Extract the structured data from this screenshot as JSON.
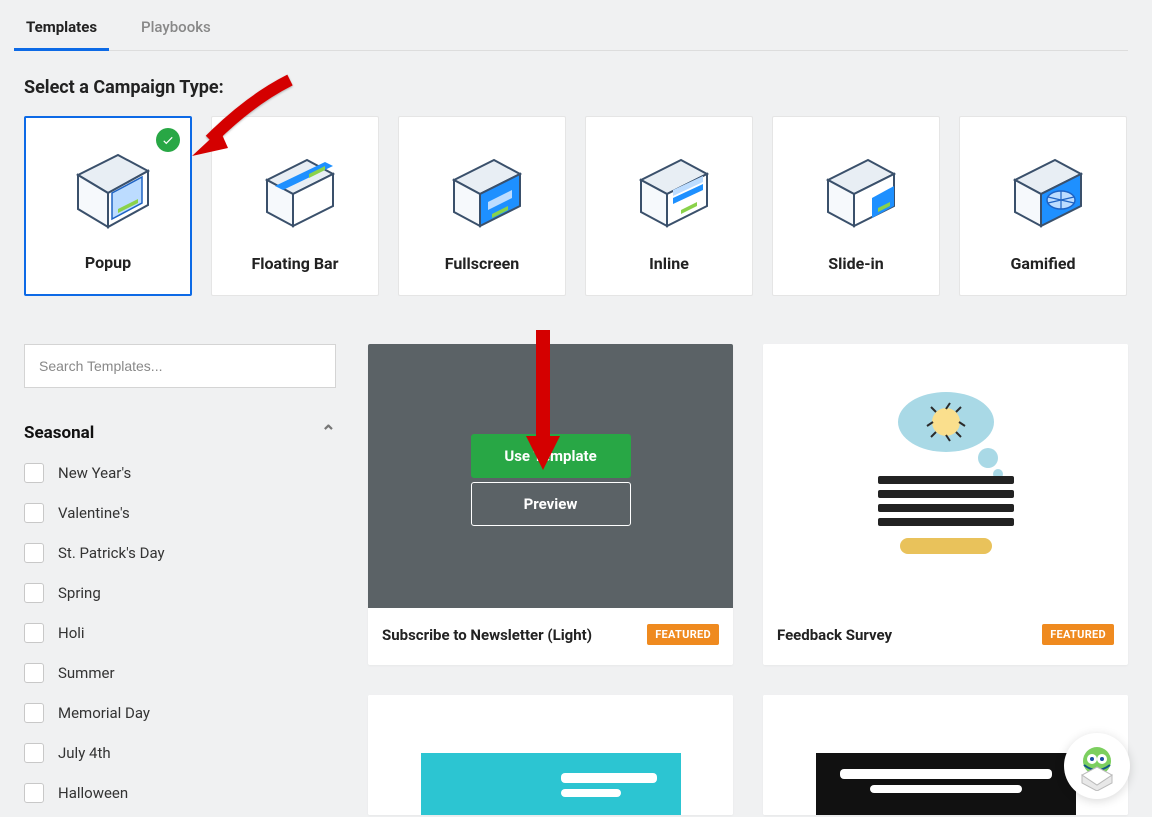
{
  "tabs": [
    {
      "label": "Templates",
      "active": true
    },
    {
      "label": "Playbooks",
      "active": false
    }
  ],
  "section_title": "Select a Campaign Type:",
  "types": [
    {
      "label": "Popup",
      "selected": true
    },
    {
      "label": "Floating Bar",
      "selected": false
    },
    {
      "label": "Fullscreen",
      "selected": false
    },
    {
      "label": "Inline",
      "selected": false
    },
    {
      "label": "Slide-in",
      "selected": false
    },
    {
      "label": "Gamified",
      "selected": false
    }
  ],
  "search": {
    "placeholder": "Search Templates..."
  },
  "filters": {
    "title": "Seasonal",
    "expanded": true,
    "items": [
      {
        "label": "New Year's"
      },
      {
        "label": "Valentine's"
      },
      {
        "label": "St. Patrick's Day"
      },
      {
        "label": "Spring"
      },
      {
        "label": "Holi"
      },
      {
        "label": "Summer"
      },
      {
        "label": "Memorial Day"
      },
      {
        "label": "July 4th"
      },
      {
        "label": "Halloween"
      }
    ]
  },
  "templates": [
    {
      "title": "Subscribe to Newsletter (Light)",
      "badge": "FEATURED",
      "hovered": true
    },
    {
      "title": "Feedback Survey",
      "badge": "FEATURED",
      "hovered": false
    }
  ],
  "hover_actions": {
    "use": "Use Template",
    "preview": "Preview"
  },
  "colors": {
    "accent": "#0d6ae6",
    "success": "#28a745",
    "badge": "#ef8a1f",
    "dark_thumb": "#5b6266"
  }
}
